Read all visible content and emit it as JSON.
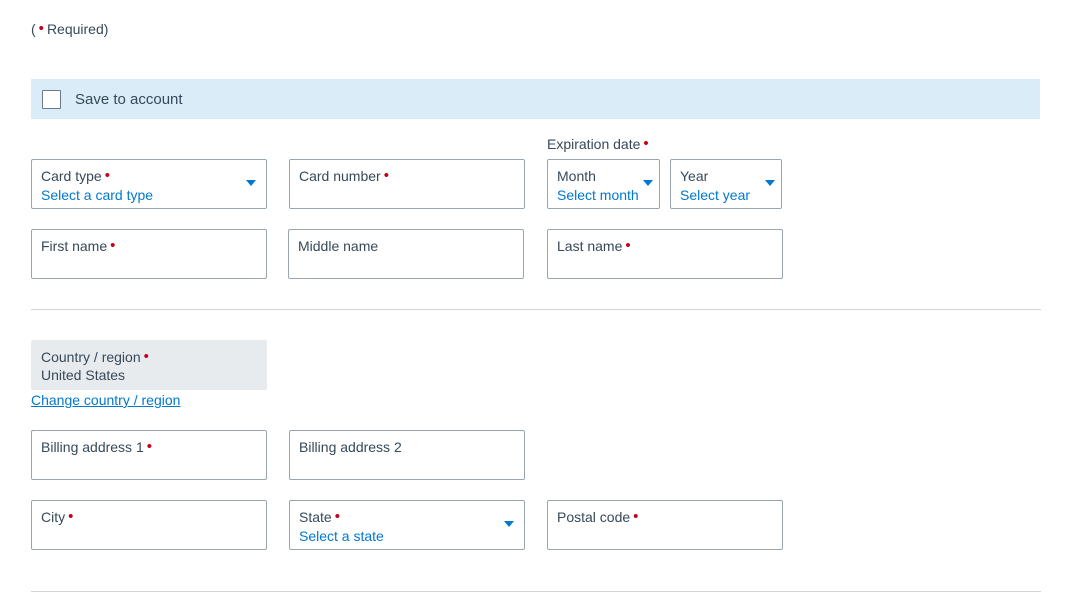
{
  "required_note": {
    "prefix": "(",
    "suffix": "Required)"
  },
  "save_bar": {
    "label": "Save to account",
    "checked": false
  },
  "expiration": {
    "label": "Expiration date"
  },
  "card_type": {
    "label": "Card type",
    "placeholder": "Select a card type"
  },
  "card_number": {
    "label": "Card number",
    "value": ""
  },
  "month": {
    "label": "Month",
    "placeholder": "Select month"
  },
  "year": {
    "label": "Year",
    "placeholder": "Select year"
  },
  "first_name": {
    "label": "First name",
    "value": ""
  },
  "middle_name": {
    "label": "Middle name",
    "value": ""
  },
  "last_name": {
    "label": "Last name",
    "value": ""
  },
  "country": {
    "label": "Country / region",
    "value": "United States"
  },
  "change_country": {
    "label": "Change country / region"
  },
  "billing1": {
    "label": "Billing address 1",
    "value": ""
  },
  "billing2": {
    "label": "Billing address 2",
    "value": ""
  },
  "city": {
    "label": "City",
    "value": ""
  },
  "state": {
    "label": "State",
    "placeholder": "Select a state"
  },
  "postal": {
    "label": "Postal code",
    "value": ""
  },
  "colors": {
    "accent": "#0078d2",
    "required": "#c30019",
    "save_bar_bg": "#d9ecf8",
    "readonly_bg": "#e8ebee",
    "text": "#36495a"
  },
  "icons": {
    "dropdown": "chevron-down-icon",
    "checkbox": "checkbox-icon"
  }
}
